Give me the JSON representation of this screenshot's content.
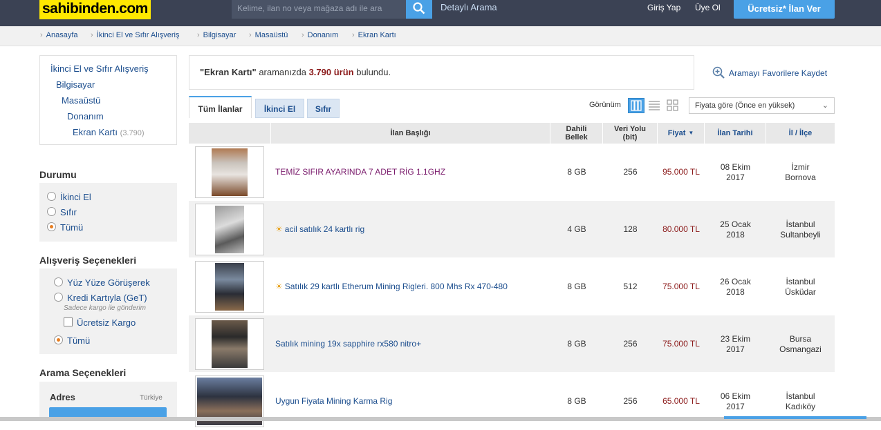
{
  "header": {
    "logo": "sahibinden.com",
    "search_placeholder": "Kelime, ilan no veya mağaza adı ile ara",
    "detailed_search": "Detaylı Arama",
    "login": "Giriş Yap",
    "register": "Üye Ol",
    "post_ad": "Ücretsiz* İlan Ver"
  },
  "breadcrumb": [
    "Anasayfa",
    "İkinci El ve Sıfır Alışveriş",
    "Bilgisayar",
    "Masaüstü",
    "Donanım",
    "Ekran Kartı"
  ],
  "categories": [
    {
      "label": "İkinci El ve Sıfır Alışveriş"
    },
    {
      "label": "Bilgisayar"
    },
    {
      "label": "Masaüstü"
    },
    {
      "label": "Donanım"
    },
    {
      "label": "Ekran Kartı",
      "count": "(3.790)"
    }
  ],
  "durumu": {
    "title": "Durumu",
    "options": [
      "İkinci El",
      "Sıfır",
      "Tümü"
    ],
    "selected": "Tümü"
  },
  "alisveris": {
    "title": "Alışveriş Seçenekleri",
    "yuz_yuze": "Yüz Yüze Görüşerek",
    "kredi": "Kredi Kartıyla (GeT)",
    "kredi_note": "Sadece kargo ile gönderim",
    "ucretsiz_kargo": "Ücretsiz Kargo",
    "tumu": "Tümü"
  },
  "arama": {
    "title": "Arama Seçenekleri",
    "adres": "Adres",
    "country": "Türkiye"
  },
  "result": {
    "query": "\"Ekran Kartı\"",
    "middle": " aramanızda ",
    "count": "3.790 ürün",
    "suffix": " bulundu."
  },
  "save_search": "Aramayı Favorilere Kaydet",
  "tabs": [
    "Tüm İlanlar",
    "İkinci El",
    "Sıfır"
  ],
  "view_label": "Görünüm",
  "sort": "Fiyata göre (Önce en yüksek)",
  "columns": {
    "title": "İlan Başlığı",
    "memory": "Dahili Bellek",
    "bus": "Veri Yolu (bit)",
    "price": "Fiyat",
    "date": "İlan Tarihi",
    "location": "İl / İlçe"
  },
  "listings": [
    {
      "title": "TEMİZ SIFIR AYARINDA 7 ADET RİG 1.1GHZ",
      "featured": false,
      "memory": "8 GB",
      "bus": "256",
      "price": "95.000 TL",
      "date1": "08 Ekim",
      "date2": "2017",
      "city": "İzmir",
      "district": "Bornova"
    },
    {
      "title": "acil satılık 24 kartlı rig",
      "featured": true,
      "memory": "4 GB",
      "bus": "128",
      "price": "80.000 TL",
      "date1": "25 Ocak",
      "date2": "2018",
      "city": "İstanbul",
      "district": "Sultanbeyli"
    },
    {
      "title": "Satılık 29 kartlı Etherum Mining Rigleri. 800 Mhs Rx 470-480",
      "featured": true,
      "memory": "8 GB",
      "bus": "512",
      "price": "75.000 TL",
      "date1": "26 Ocak",
      "date2": "2018",
      "city": "İstanbul",
      "district": "Üsküdar"
    },
    {
      "title": "Satılık mining 19x sapphire rx580 nitro+",
      "featured": false,
      "memory": "8 GB",
      "bus": "256",
      "price": "75.000 TL",
      "date1": "23 Ekim",
      "date2": "2017",
      "city": "Bursa",
      "district": "Osmangazi"
    },
    {
      "title": "Uygun Fiyata Mining Karma Rig",
      "featured": false,
      "memory": "8 GB",
      "bus": "256",
      "price": "65.000 TL",
      "date1": "06 Ekim",
      "date2": "2017",
      "city": "İstanbul",
      "district": "Kadıköy"
    }
  ],
  "colors": {
    "accent": "#4aa1e6",
    "header": "#3b4254",
    "logo": "#ffe800",
    "price": "#8b1a1a",
    "link": "#1c4e8e"
  }
}
